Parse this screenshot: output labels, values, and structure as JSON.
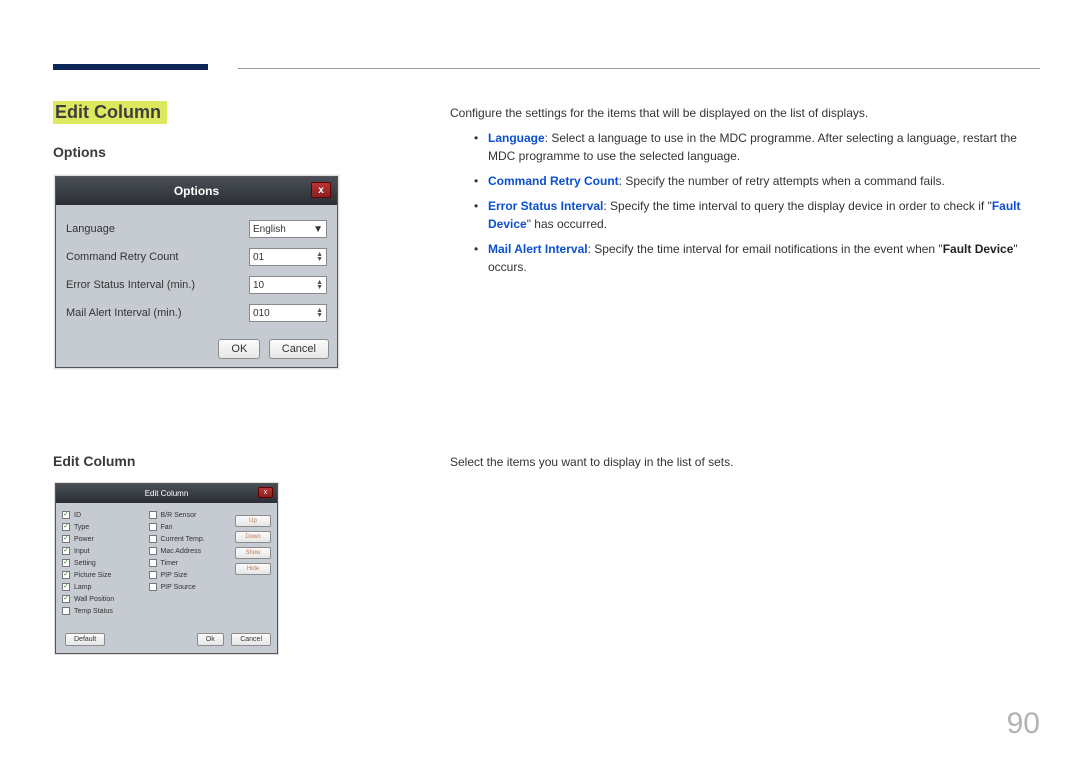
{
  "page_number": "90",
  "heading_main": "Edit Column",
  "heading_options": "Options",
  "heading_editcolumn": "Edit Column",
  "options_dialog": {
    "title": "Options",
    "rows": {
      "language": {
        "label": "Language",
        "value": "English"
      },
      "retry": {
        "label": "Command Retry Count",
        "value": "01"
      },
      "error": {
        "label": "Error Status Interval (min.)",
        "value": "10"
      },
      "mail": {
        "label": "Mail Alert Interval (min.)",
        "value": "010"
      }
    },
    "ok": "OK",
    "cancel": "Cancel"
  },
  "ec_dialog": {
    "title": "Edit Column",
    "col1": {
      "i0": "ID",
      "i1": "Type",
      "i2": "Power",
      "i3": "Input",
      "i4": "Setting",
      "i5": "Picture Size",
      "i6": "Lamp",
      "i7": "Wall Position",
      "i8": "Temp Status"
    },
    "col2": {
      "i0": "B/R Sensor",
      "i1": "Fan",
      "i2": "Current Temp.",
      "i3": "Mac Address",
      "i4": "Timer",
      "i5": "PIP Size",
      "i6": "PIP Source"
    },
    "btns": {
      "up": "Up",
      "down": "Down",
      "show": "Show",
      "hide": "Hide"
    },
    "default": "Default",
    "ok": "Ok",
    "cancel": "Cancel"
  },
  "right": {
    "intro": "Configure the settings for the items that will be displayed on the list of displays.",
    "li1a": "Language",
    "li1b": ": Select a language to use in the MDC programme. After selecting a language, restart the MDC programme to use the selected language.",
    "li2a": "Command Retry Count",
    "li2b": ": Specify the number of retry attempts when a command fails.",
    "li3a": "Error Status Interval",
    "li3b": ": Specify the time interval to query the display device in order to check if \"",
    "li3c": "Fault Device",
    "li3d": "\" has occurred.",
    "li4a": "Mail Alert Interval",
    "li4b": ": Specify the time interval for email notifications in the event when \"",
    "li4c": "Fault Device",
    "li4d": "\" occurs.",
    "ec_desc": "Select the items you want to display in the list of sets."
  }
}
